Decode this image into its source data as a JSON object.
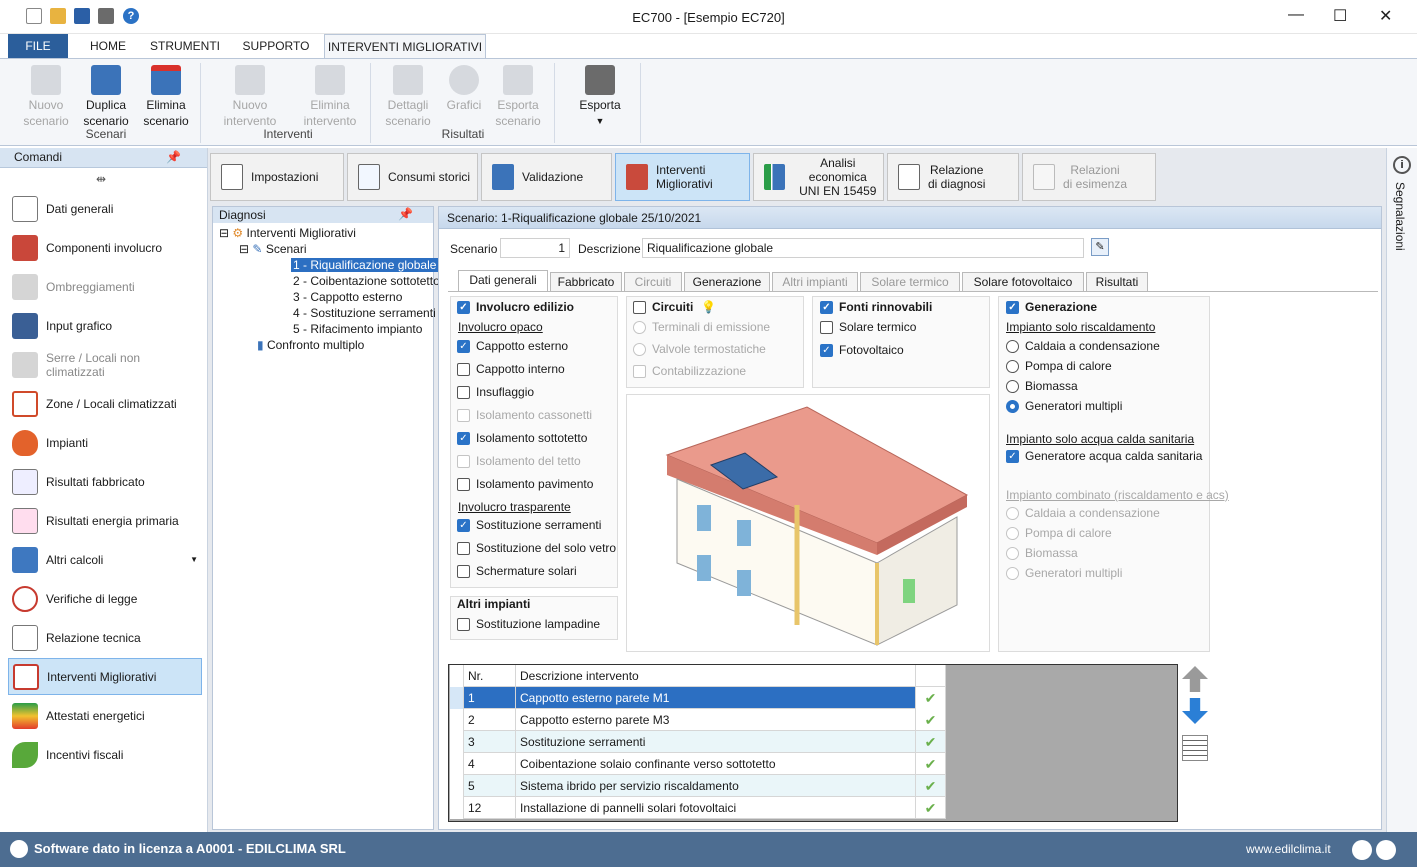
{
  "window": {
    "title": "EC700 - [Esempio EC720]"
  },
  "ribbon_tabs": [
    "FILE",
    "HOME",
    "STRUMENTI",
    "SUPPORTO",
    "INTERVENTI MIGLIORATIVI"
  ],
  "ribbon": {
    "groups": [
      "Scenari",
      "Interventi",
      "Risultati"
    ],
    "buttons": [
      {
        "line1": "Nuovo",
        "line2": "scenario"
      },
      {
        "line1": "Duplica",
        "line2": "scenario"
      },
      {
        "line1": "Elimina",
        "line2": "scenario"
      },
      {
        "line1": "Nuovo",
        "line2": "intervento"
      },
      {
        "line1": "Elimina",
        "line2": "intervento"
      },
      {
        "line1": "Dettagli",
        "line2": "scenario"
      },
      {
        "line1": "Grafici",
        "line2": ""
      },
      {
        "line1": "Esporta",
        "line2": "scenario"
      },
      {
        "line1": "Esporta",
        "line2": ""
      }
    ]
  },
  "commands": {
    "title": "Comandi",
    "items": [
      "Dati generali",
      "Componenti involucro",
      "Ombreggiamenti",
      "Input grafico",
      "Serre / Locali non climatizzati",
      "Zone / Locali climatizzati",
      "Impianti",
      "Risultati fabbricato",
      "Risultati energia primaria",
      "Altri calcoli",
      "Verifiche di legge",
      "Relazione tecnica",
      "Interventi Migliorativi",
      "Attestati energetici",
      "Incentivi fiscali"
    ]
  },
  "top_tabs": [
    {
      "line1": "Impostazioni",
      "line2": ""
    },
    {
      "line1": "Consumi storici",
      "line2": ""
    },
    {
      "line1": "Validazione",
      "line2": ""
    },
    {
      "line1": "Interventi",
      "line2": "Migliorativi"
    },
    {
      "line1": "Analisi economica",
      "line2": "UNI EN 15459"
    },
    {
      "line1": "Relazione",
      "line2": "di diagnosi"
    },
    {
      "line1": "Relazioni",
      "line2": "di esimenza"
    }
  ],
  "diagnosi": {
    "title": "Diagnosi",
    "root": "Interventi Migliorativi",
    "scenari": "Scenari",
    "items": [
      "1 - Riqualificazione globale",
      "2 - Coibentazione sottotetto",
      "3 - Cappotto esterno",
      "4 - Sostituzione serramenti",
      "5 - Rifacimento impianto"
    ],
    "confronto": "Confronto multiplo"
  },
  "scenario": {
    "header": "Scenario: 1-Riqualificazione globale 25/10/2021",
    "label_scenario": "Scenario",
    "value": "1",
    "label_desc": "Descrizione",
    "desc": "Riqualificazione globale"
  },
  "sub_tabs": [
    "Dati generali",
    "Fabbricato",
    "Circuiti",
    "Generazione",
    "Altri impianti",
    "Solare termico",
    "Solare fotovoltaico",
    "Risultati"
  ],
  "involucro": {
    "title": "Involucro edilizio",
    "opaco": "Involucro opaco",
    "opaco_items": [
      "Cappotto esterno",
      "Cappotto interno",
      "Insuflaggio",
      "Isolamento cassonetti",
      "Isolamento sottotetto",
      "Isolamento del tetto",
      "Isolamento pavimento"
    ],
    "trasparente": "Involucro trasparente",
    "trasp_items": [
      "Sostituzione serramenti",
      "Sostituzione del solo vetro",
      "Schermature solari"
    ]
  },
  "altri": {
    "title": "Altri impianti",
    "item": "Sostituzione lampadine"
  },
  "circuiti": {
    "title": "Circuiti",
    "items": [
      "Terminali di emissione",
      "Valvole termostatiche",
      "Contabilizzazione"
    ]
  },
  "fonti": {
    "title": "Fonti rinnovabili",
    "items": [
      "Solare termico",
      "Fotovoltaico"
    ]
  },
  "generazione": {
    "title": "Generazione",
    "risc": "Impianto solo riscaldamento",
    "risc_items": [
      "Caldaia a condensazione",
      "Pompa di calore",
      "Biomassa",
      "Generatori multipli"
    ],
    "acs": "Impianto solo acqua calda sanitaria",
    "acs_item": "Generatore acqua calda sanitaria",
    "comb": "Impianto combinato (riscaldamento e acs)",
    "comb_items": [
      "Caldaia a condensazione",
      "Pompa di calore",
      "Biomassa",
      "Generatori multipli"
    ]
  },
  "table": {
    "col_nr": "Nr.",
    "col_desc": "Descrizione intervento",
    "rows": [
      {
        "nr": "1",
        "desc": "Cappotto esterno parete M1"
      },
      {
        "nr": "2",
        "desc": "Cappotto esterno parete M3"
      },
      {
        "nr": "3",
        "desc": "Sostituzione serramenti"
      },
      {
        "nr": "4",
        "desc": "Coibentazione solaio confinante verso sottotetto"
      },
      {
        "nr": "5",
        "desc": "Sistema ibrido per servizio riscaldamento"
      },
      {
        "nr": "12",
        "desc": "Installazione di pannelli solari fotovoltaici"
      }
    ],
    "check": "✔"
  },
  "side_panel": "Segnalazioni",
  "status": {
    "license": "Software dato in licenza a A0001 - EDILCLIMA SRL",
    "site": "www.edilclima.it"
  }
}
